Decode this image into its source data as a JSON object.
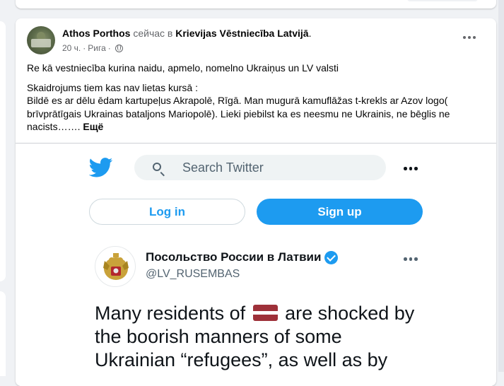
{
  "post": {
    "author_name": "Athos Porthos",
    "action_text": "сейчас в",
    "group_name": "Krievijas Vēstniecība Latvijā",
    "time": "20 ч.",
    "separator": "·",
    "location": "Рига",
    "paragraph1": "Re kā vestniecība kurina naidu, apmelo, nomelno Ukraiņus un LV valsti",
    "paragraph2_line1": "Skaidrojums tiem kas nav lietas kursā :",
    "paragraph2_rest": "Bildē es ar dēlu ēdam kartupeļus Akrapolē, Rīgā. Man mugurā kamuflāžas t-krekls ar Azov logo( brīvprātīgais Ukrainas bataljons Mariopolē). Lieki piebilst ka es neesmu ne Ukrainis, ne bēglis ne nacists…….",
    "see_more": "Ещё",
    "icons": {
      "more": "more-options-icon",
      "privacy": "globe-icon"
    }
  },
  "embedded_tweet": {
    "search_placeholder": "Search Twitter",
    "login_label": "Log in",
    "signup_label": "Sign up",
    "account_name": "Посольство России в Латвии",
    "account_handle": "@LV_RUSEMBAS",
    "text_before_flag": "Many residents of",
    "text_after_flag": "are shocked by the boorish manners of some Ukrainian “refugees”, as well as by",
    "colors": {
      "twitter_blue": "#1d9bf0",
      "latvia_carmine": "#9e3039"
    },
    "icons": {
      "logo": "twitter-bird-icon",
      "search": "search-icon",
      "verified": "verified-badge-icon",
      "flag": "latvia-flag-icon"
    }
  }
}
